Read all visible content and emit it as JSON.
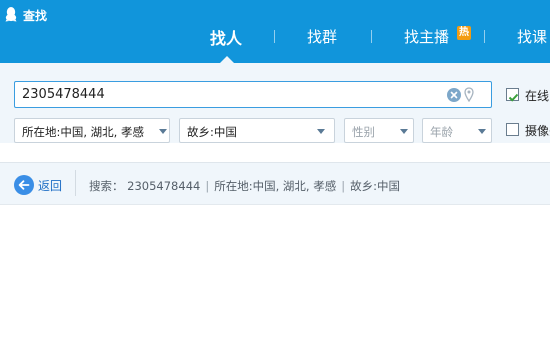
{
  "header": {
    "title": "查找",
    "tabs": [
      {
        "label": "找人",
        "active": true
      },
      {
        "label": "找群",
        "active": false
      },
      {
        "label": "找主播",
        "active": false,
        "badge": "热"
      },
      {
        "label": "找课",
        "active": false
      }
    ]
  },
  "search": {
    "query": "2305478444",
    "online_label": "在线",
    "camera_label": "摄像头"
  },
  "filters": {
    "location": "所在地:中国, 湖北, 孝感",
    "hometown": "故乡:中国",
    "gender_placeholder": "性别",
    "age_placeholder": "年龄"
  },
  "results_bar": {
    "back_label": "返回",
    "summary_prefix": "搜索：",
    "summary_query": "2305478444",
    "summary_location": "所在地:中国, 湖北, 孝感",
    "summary_hometown": "故乡:中国"
  },
  "colors": {
    "header_bg": "#1195db",
    "panel_bg": "#f0f6fb",
    "hot_badge": "#f39c12",
    "link": "#1f6fc5"
  },
  "icons": [
    "qq-penguin-icon",
    "clear-icon",
    "location-pin-icon",
    "check-icon",
    "back-arrow-icon",
    "chevron-down-icon"
  ]
}
